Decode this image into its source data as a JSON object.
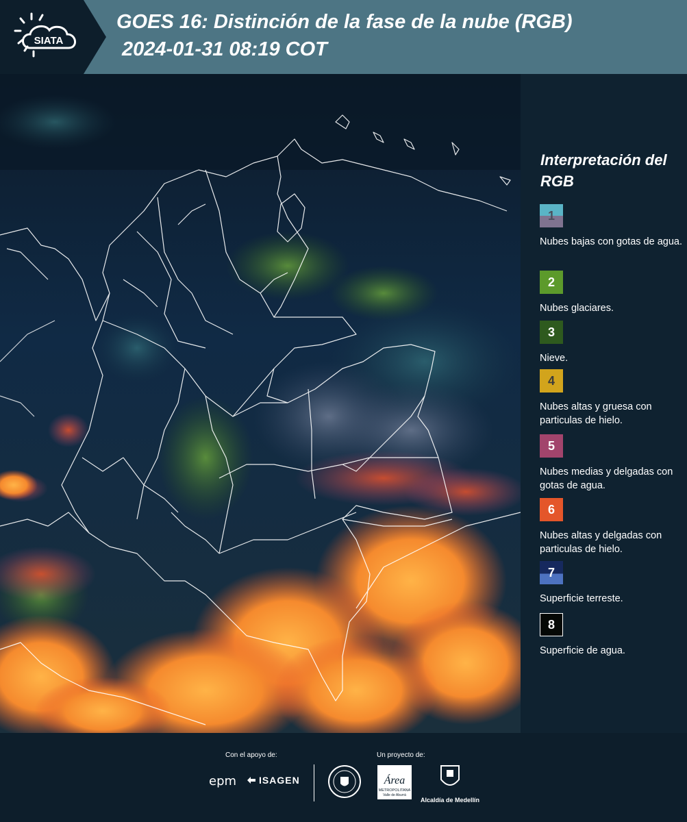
{
  "header": {
    "logo_text": "SIATA",
    "title_line1": "GOES 16: Distinción de la fase de la nube (RGB)",
    "title_line2": "2024-01-31 08:19 COT",
    "bg_color": "#4d7584"
  },
  "legend": {
    "title": "Interpretación del RGB",
    "items": [
      {
        "number": "1",
        "text": "Nubes bajas con gotas de agua.",
        "color_top": "#5ab4c6",
        "color_bottom": "#7f7390"
      },
      {
        "number": "2",
        "text": "Nubes glaciares.",
        "color_top": "#5c9a2b",
        "color_bottom": "#5c9a2b"
      },
      {
        "number": "3",
        "text": "Nieve.",
        "color_top": "#2e5a1e",
        "color_bottom": "#2e5a1e"
      },
      {
        "number": "4",
        "text": "Nubes altas y gruesa con particulas de hielo.",
        "color_top": "#d2a41c",
        "color_bottom": "#d2a41c"
      },
      {
        "number": "5",
        "text": "Nubes medias y delgadas con gotas de agua.",
        "color_top": "#a2446c",
        "color_bottom": "#a2446c"
      },
      {
        "number": "6",
        "text": "Nubes altas y delgadas con particulas de hielo.",
        "color_top": "#e4562a",
        "color_bottom": "#e4562a"
      },
      {
        "number": "7",
        "text": "Superficie terreste.",
        "color_top": "#16295e",
        "color_bottom": "#4d72c0"
      },
      {
        "number": "8",
        "text": "Superficie de agua.",
        "color_top": "#050805",
        "color_bottom": "#050805"
      }
    ]
  },
  "footer": {
    "support_label": "Con el apoyo de:",
    "project_label": "Un proyecto de:",
    "sponsor1": "epm",
    "sponsor2": "ISAGEN",
    "area_text": "Área",
    "area_sub1": "METROPOLITANA",
    "area_sub2": "Valle de Aburrá",
    "alcaldia": "Alcaldía de Medellín"
  }
}
